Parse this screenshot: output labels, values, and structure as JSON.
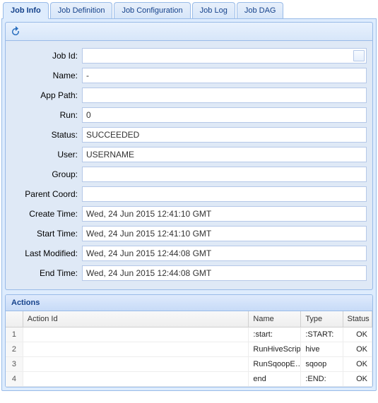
{
  "tabs": [
    {
      "label": "Job Info",
      "active": true
    },
    {
      "label": "Job Definition",
      "active": false
    },
    {
      "label": "Job Configuration",
      "active": false
    },
    {
      "label": "Job Log",
      "active": false
    },
    {
      "label": "Job DAG",
      "active": false
    }
  ],
  "form": {
    "fields": {
      "jobId": {
        "label": "Job Id:",
        "value": ""
      },
      "name": {
        "label": "Name:",
        "value": "-"
      },
      "appPath": {
        "label": "App Path:",
        "value": ""
      },
      "run": {
        "label": "Run:",
        "value": "0"
      },
      "status": {
        "label": "Status:",
        "value": "SUCCEEDED"
      },
      "user": {
        "label": "User:",
        "value": "USERNAME"
      },
      "group": {
        "label": "Group:",
        "value": ""
      },
      "parentCoord": {
        "label": "Parent Coord:",
        "value": ""
      },
      "createTime": {
        "label": "Create Time:",
        "value": "Wed, 24 Jun 2015 12:41:10 GMT"
      },
      "startTime": {
        "label": "Start Time:",
        "value": "Wed, 24 Jun 2015 12:41:10 GMT"
      },
      "lastModified": {
        "label": "Last Modified:",
        "value": "Wed, 24 Jun 2015 12:44:08 GMT"
      },
      "endTime": {
        "label": "End Time:",
        "value": "Wed, 24 Jun 2015 12:44:08 GMT"
      }
    }
  },
  "actions": {
    "title": "Actions",
    "columns": {
      "actionId": "Action Id",
      "name": "Name",
      "type": "Type",
      "status": "Status"
    },
    "rows": [
      {
        "num": "1",
        "actionId": "",
        "name": ":start:",
        "type": ":START:",
        "status": "OK"
      },
      {
        "num": "2",
        "actionId": "",
        "name": "RunHiveScript",
        "type": "hive",
        "status": "OK"
      },
      {
        "num": "3",
        "actionId": "",
        "name": "RunSqoopE…",
        "type": "sqoop",
        "status": "OK"
      },
      {
        "num": "4",
        "actionId": "",
        "name": "end",
        "type": ":END:",
        "status": "OK"
      }
    ]
  }
}
